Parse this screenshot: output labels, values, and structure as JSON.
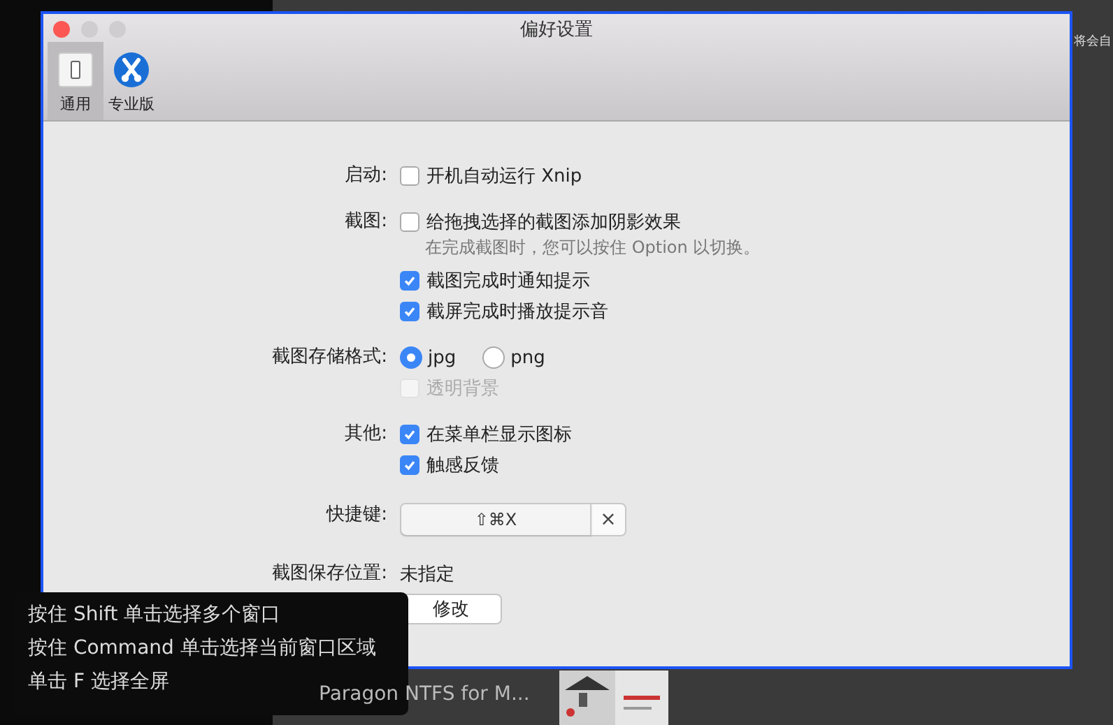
{
  "background": {
    "top_text": "将会自",
    "bottom_text": "Paragon NTFS for M..."
  },
  "window": {
    "title": "偏好设置"
  },
  "toolbar": [
    {
      "label": "通用",
      "selected": true,
      "kind": "switch"
    },
    {
      "label": "专业版",
      "selected": false,
      "kind": "scissors"
    }
  ],
  "sections": [
    {
      "label": "启动:",
      "options": [
        {
          "kind": "checkbox",
          "label": "开机自动运行 Xnip",
          "checked": false
        }
      ]
    },
    {
      "label": "截图:",
      "options": [
        {
          "kind": "checkbox",
          "label": "给拖拽选择的截图添加阴影效果",
          "checked": false,
          "hint": "在完成截图时，您可以按住 Option 以切换。"
        },
        {
          "kind": "checkbox",
          "label": "截图完成时通知提示",
          "checked": true
        },
        {
          "kind": "checkbox",
          "label": "截屏完成时播放提示音",
          "checked": true
        }
      ]
    },
    {
      "label": "截图存储格式:",
      "options": [
        {
          "kind": "radio_group",
          "choices": [
            {
              "label": "jpg",
              "selected": true
            },
            {
              "label": "png",
              "selected": false
            }
          ]
        },
        {
          "kind": "checkbox",
          "label": "透明背景",
          "checked": false,
          "disabled": true
        }
      ]
    },
    {
      "label": "其他:",
      "options": [
        {
          "kind": "checkbox",
          "label": "在菜单栏显示图标",
          "checked": true
        },
        {
          "kind": "checkbox",
          "label": "触感反馈",
          "checked": true
        }
      ]
    },
    {
      "label": "快捷键:",
      "options": [
        {
          "kind": "shortcut",
          "value": "⇧⌘X",
          "clear": "×"
        }
      ]
    },
    {
      "label": "截图保存位置:",
      "options": [
        {
          "kind": "text",
          "value": "未指定"
        },
        {
          "kind": "button",
          "label": "修改"
        }
      ]
    }
  ],
  "tooltip": {
    "lines": [
      "按住 Shift 单击选择多个窗口",
      "按住 Command 单击选择当前窗口区域",
      "单击 F 选择全屏"
    ]
  }
}
